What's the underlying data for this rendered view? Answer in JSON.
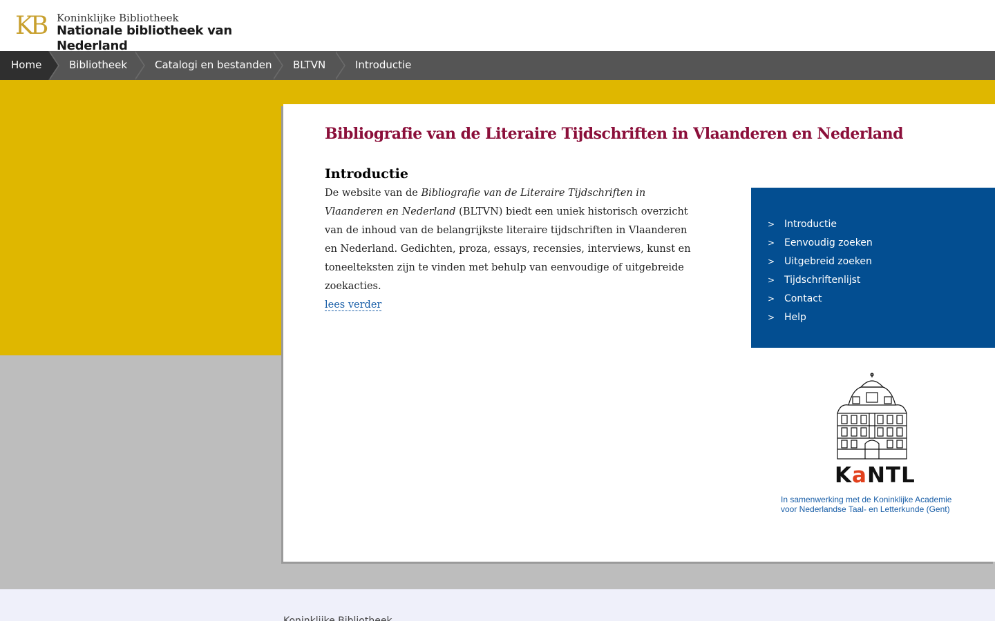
{
  "header": {
    "logo_mark": "KB",
    "logo_line1": "Koninklijke Bibliotheek",
    "logo_line2": "Nationale bibliotheek van Nederland"
  },
  "breadcrumb": [
    {
      "label": "Home"
    },
    {
      "label": "Bibliotheek"
    },
    {
      "label": "Catalogi en bestanden"
    },
    {
      "label": "BLTVN"
    },
    {
      "label": "Introductie"
    }
  ],
  "main": {
    "title": "Bibliografie van de Literaire Tijdschriften in Vlaanderen en Nederland",
    "intro_heading": "Introductie",
    "intro_prefix": "De website van de ",
    "intro_italic": "Bibliografie van de Literaire Tijdschriften in Vlaanderen en Nederland",
    "intro_suffix": " (BLTVN) biedt een uniek historisch overzicht van de inhoud van de belangrijkste literaire tijdschriften in Vlaanderen en Nederland. Gedichten, proza, essays, recensies, interviews, kunst en toneelteksten zijn te vinden met behulp van eenvoudige of uitgebreide zoekacties.",
    "read_more": "lees verder"
  },
  "sidenav": {
    "chevron": ">",
    "items": [
      {
        "label": "Introductie"
      },
      {
        "label": "Eenvoudig zoeken"
      },
      {
        "label": "Uitgebreid zoeken"
      },
      {
        "label": "Tijdschriftenlijst"
      },
      {
        "label": "Contact"
      },
      {
        "label": "Help"
      }
    ]
  },
  "kantl": {
    "word_k": "K",
    "word_a": "a",
    "word_rest": "NTL",
    "caption_line1": "In samenwerking met de Koninklijke Academie",
    "caption_line2": "voor Nederlandse Taal- en Letterkunde (Gent)"
  },
  "footer": {
    "logo_text": "Koninklijke Bibliotheek"
  },
  "colors": {
    "yellow": "#dfb700",
    "navy": "#034e91",
    "title": "#8b0f3a",
    "breadcrumb": "#555555"
  }
}
